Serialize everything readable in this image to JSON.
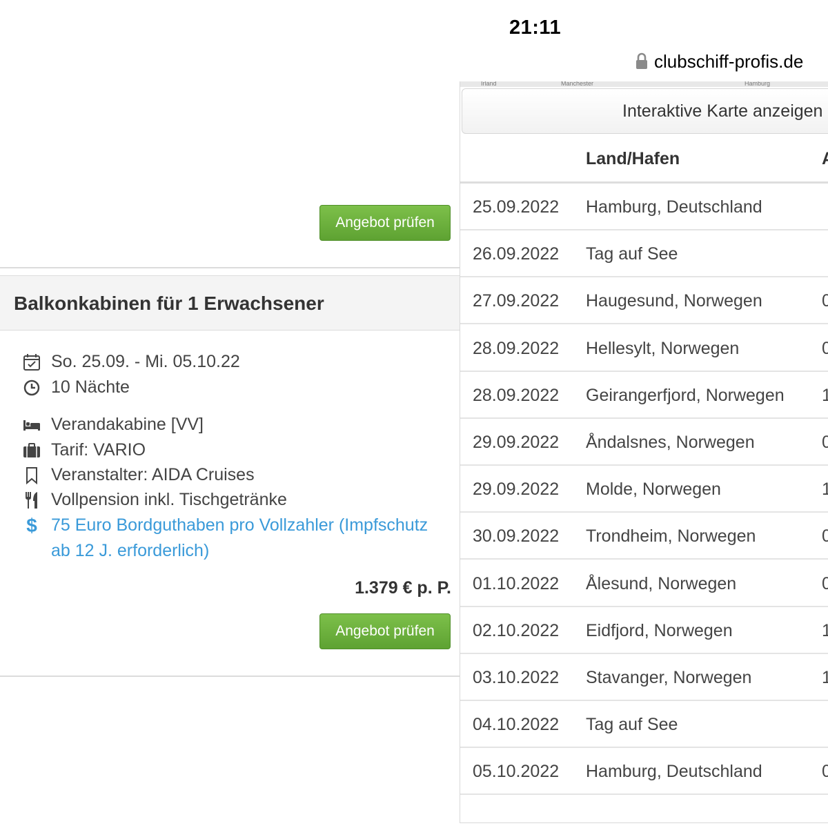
{
  "status": {
    "time": "21:11",
    "url": "clubschiff-profis.de"
  },
  "offer_button_label": "Angebot prüfen",
  "cabin": {
    "title": "Balkonkabinen für 1 Erwachsener",
    "dates": "So. 25.09. - Mi. 05.10.22",
    "nights": "10 Nächte",
    "cabin_type": "Verandakabine [VV]",
    "tariff": "Tarif: VARIO",
    "operator": "Veranstalter: AIDA Cruises",
    "board": "Vollpension inkl. Tischgetränke",
    "bonus_line1": "75 Euro Bordguthaben pro Vollzahler (Impfschutz",
    "bonus_line2": "ab 12 J. erforderlich)",
    "price": "1.379 € p. P."
  },
  "map": {
    "button_label": "Interaktive Karte anzeigen",
    "strip_labels": [
      "Irland",
      "Manchester",
      "Hamburg"
    ]
  },
  "itinerary": {
    "header_port": "Land/Hafen",
    "header_next": "A",
    "rows": [
      {
        "date": "25.09.2022",
        "port": "Hamburg, Deutschland",
        "extra": ""
      },
      {
        "date": "26.09.2022",
        "port": "Tag auf See",
        "extra": ""
      },
      {
        "date": "27.09.2022",
        "port": "Haugesund, Norwegen",
        "extra": "0"
      },
      {
        "date": "28.09.2022",
        "port": "Hellesylt, Norwegen",
        "extra": "0"
      },
      {
        "date": "28.09.2022",
        "port": "Geirangerfjord, Norwegen",
        "extra": "1"
      },
      {
        "date": "29.09.2022",
        "port": "Åndalsnes, Norwegen",
        "extra": "0"
      },
      {
        "date": "29.09.2022",
        "port": "Molde, Norwegen",
        "extra": "1"
      },
      {
        "date": "30.09.2022",
        "port": "Trondheim, Norwegen",
        "extra": "0"
      },
      {
        "date": "01.10.2022",
        "port": "Ålesund, Norwegen",
        "extra": "0"
      },
      {
        "date": "02.10.2022",
        "port": "Eidfjord, Norwegen",
        "extra": "1"
      },
      {
        "date": "03.10.2022",
        "port": "Stavanger, Norwegen",
        "extra": "1"
      },
      {
        "date": "04.10.2022",
        "port": "Tag auf See",
        "extra": ""
      },
      {
        "date": "05.10.2022",
        "port": "Hamburg, Deutschland",
        "extra": "0"
      }
    ]
  },
  "colors": {
    "button_green": "#6aac3b",
    "link_blue": "#3a9ad9",
    "text": "#333333"
  },
  "icons": [
    "lock-icon",
    "calendar-check-icon",
    "clock-icon",
    "bed-icon",
    "briefcase-icon",
    "bookmark-icon",
    "cutlery-icon",
    "dollar-icon"
  ]
}
